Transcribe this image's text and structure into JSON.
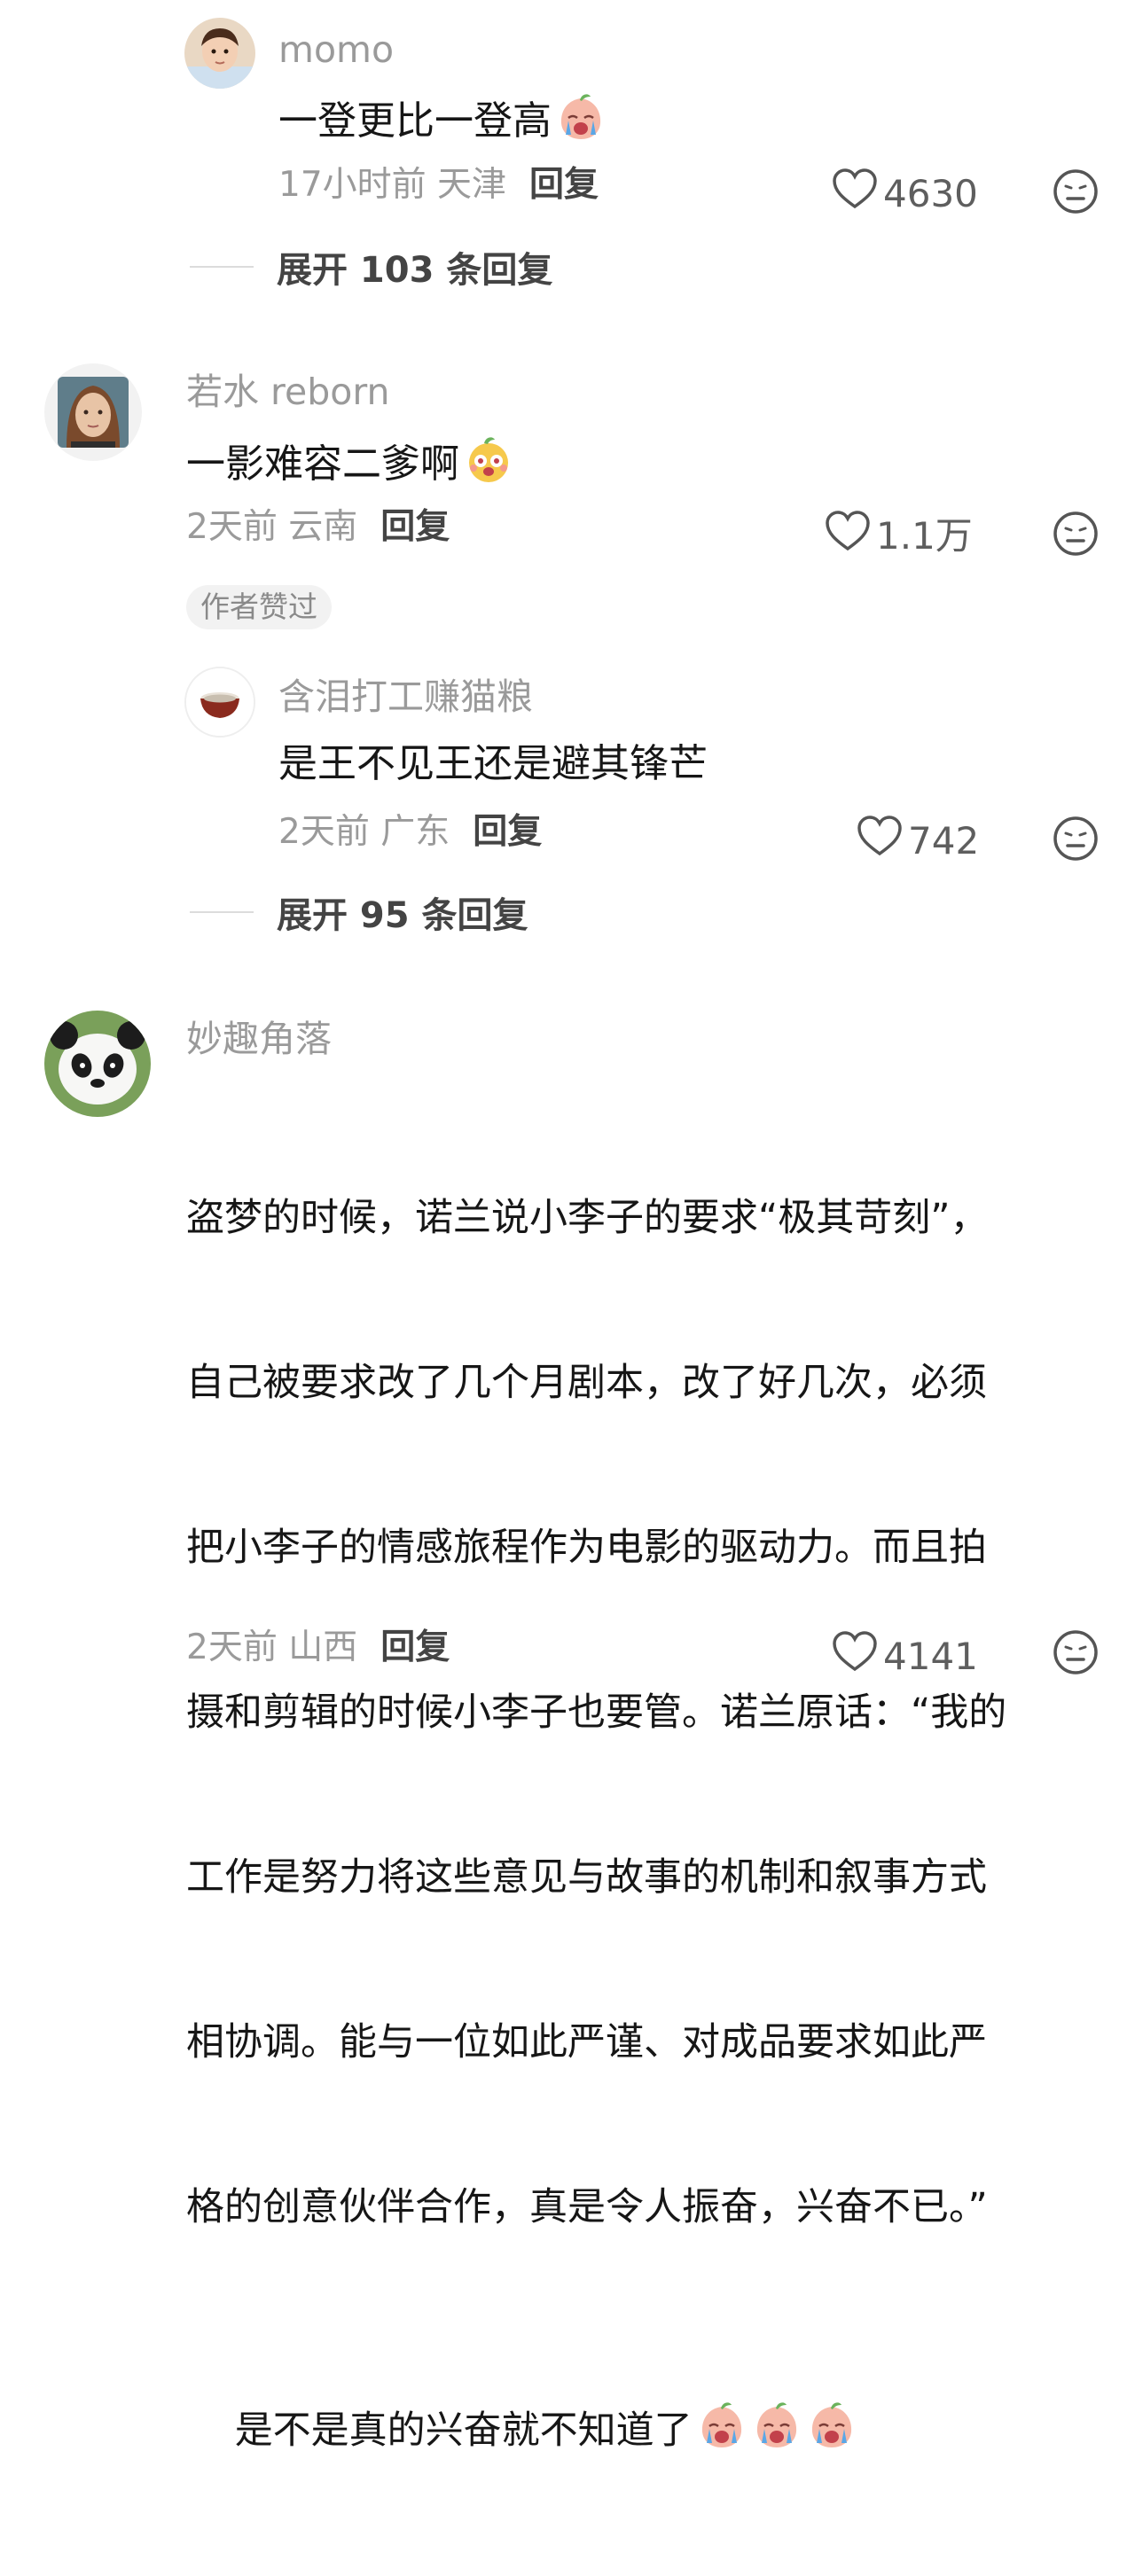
{
  "comments": [
    {
      "username": "momo",
      "text": "一登更比一登高",
      "time_location": "17小时前 天津",
      "reply_label": "回复",
      "likes": "4630",
      "expand_label": "展开 103 条回复"
    },
    {
      "username": "若水 reborn",
      "text": "一影难容二爹啊",
      "time_location": "2天前 云南",
      "reply_label": "回复",
      "likes": "1.1万",
      "badge": "作者赞过"
    },
    {
      "username": "含泪打工赚猫粮",
      "text": "是王不见王还是避其锋芒",
      "time_location": "2天前 广东",
      "reply_label": "回复",
      "likes": "742",
      "expand_label": "展开 95 条回复"
    },
    {
      "username": "妙趣角落",
      "text_lines": [
        "盗梦的时候，诺兰说小李子的要求“极其苛刻”，",
        "自己被要求改了几个月剧本，改了好几次，必须",
        "把小李子的情感旅程作为电影的驱动力。而且拍",
        "摄和剪辑的时候小李子也要管。诺兰原话：“我的",
        "工作是努力将这些意见与故事的机制和叙事方式",
        "相协调。能与一位如此严谨、对成品要求如此严",
        "格的创意伙伴合作，真是令人振奋，兴奋不已。”",
        "是不是真的兴奋就不知道了"
      ],
      "time_location": "2天前 山西",
      "reply_label": "回复",
      "likes": "4141"
    }
  ],
  "icons": {
    "like": "heart-outline-icon",
    "dislike": "meh-face-icon",
    "emoji_cry": "crying-peach-emoji",
    "emoji_cheer": "cheering-bear-emoji"
  },
  "colors": {
    "username": "#9a9a9a",
    "text": "#161616",
    "meta": "#9a9a9a",
    "reply": "#444444",
    "badge_bg": "#f2f2f2"
  }
}
